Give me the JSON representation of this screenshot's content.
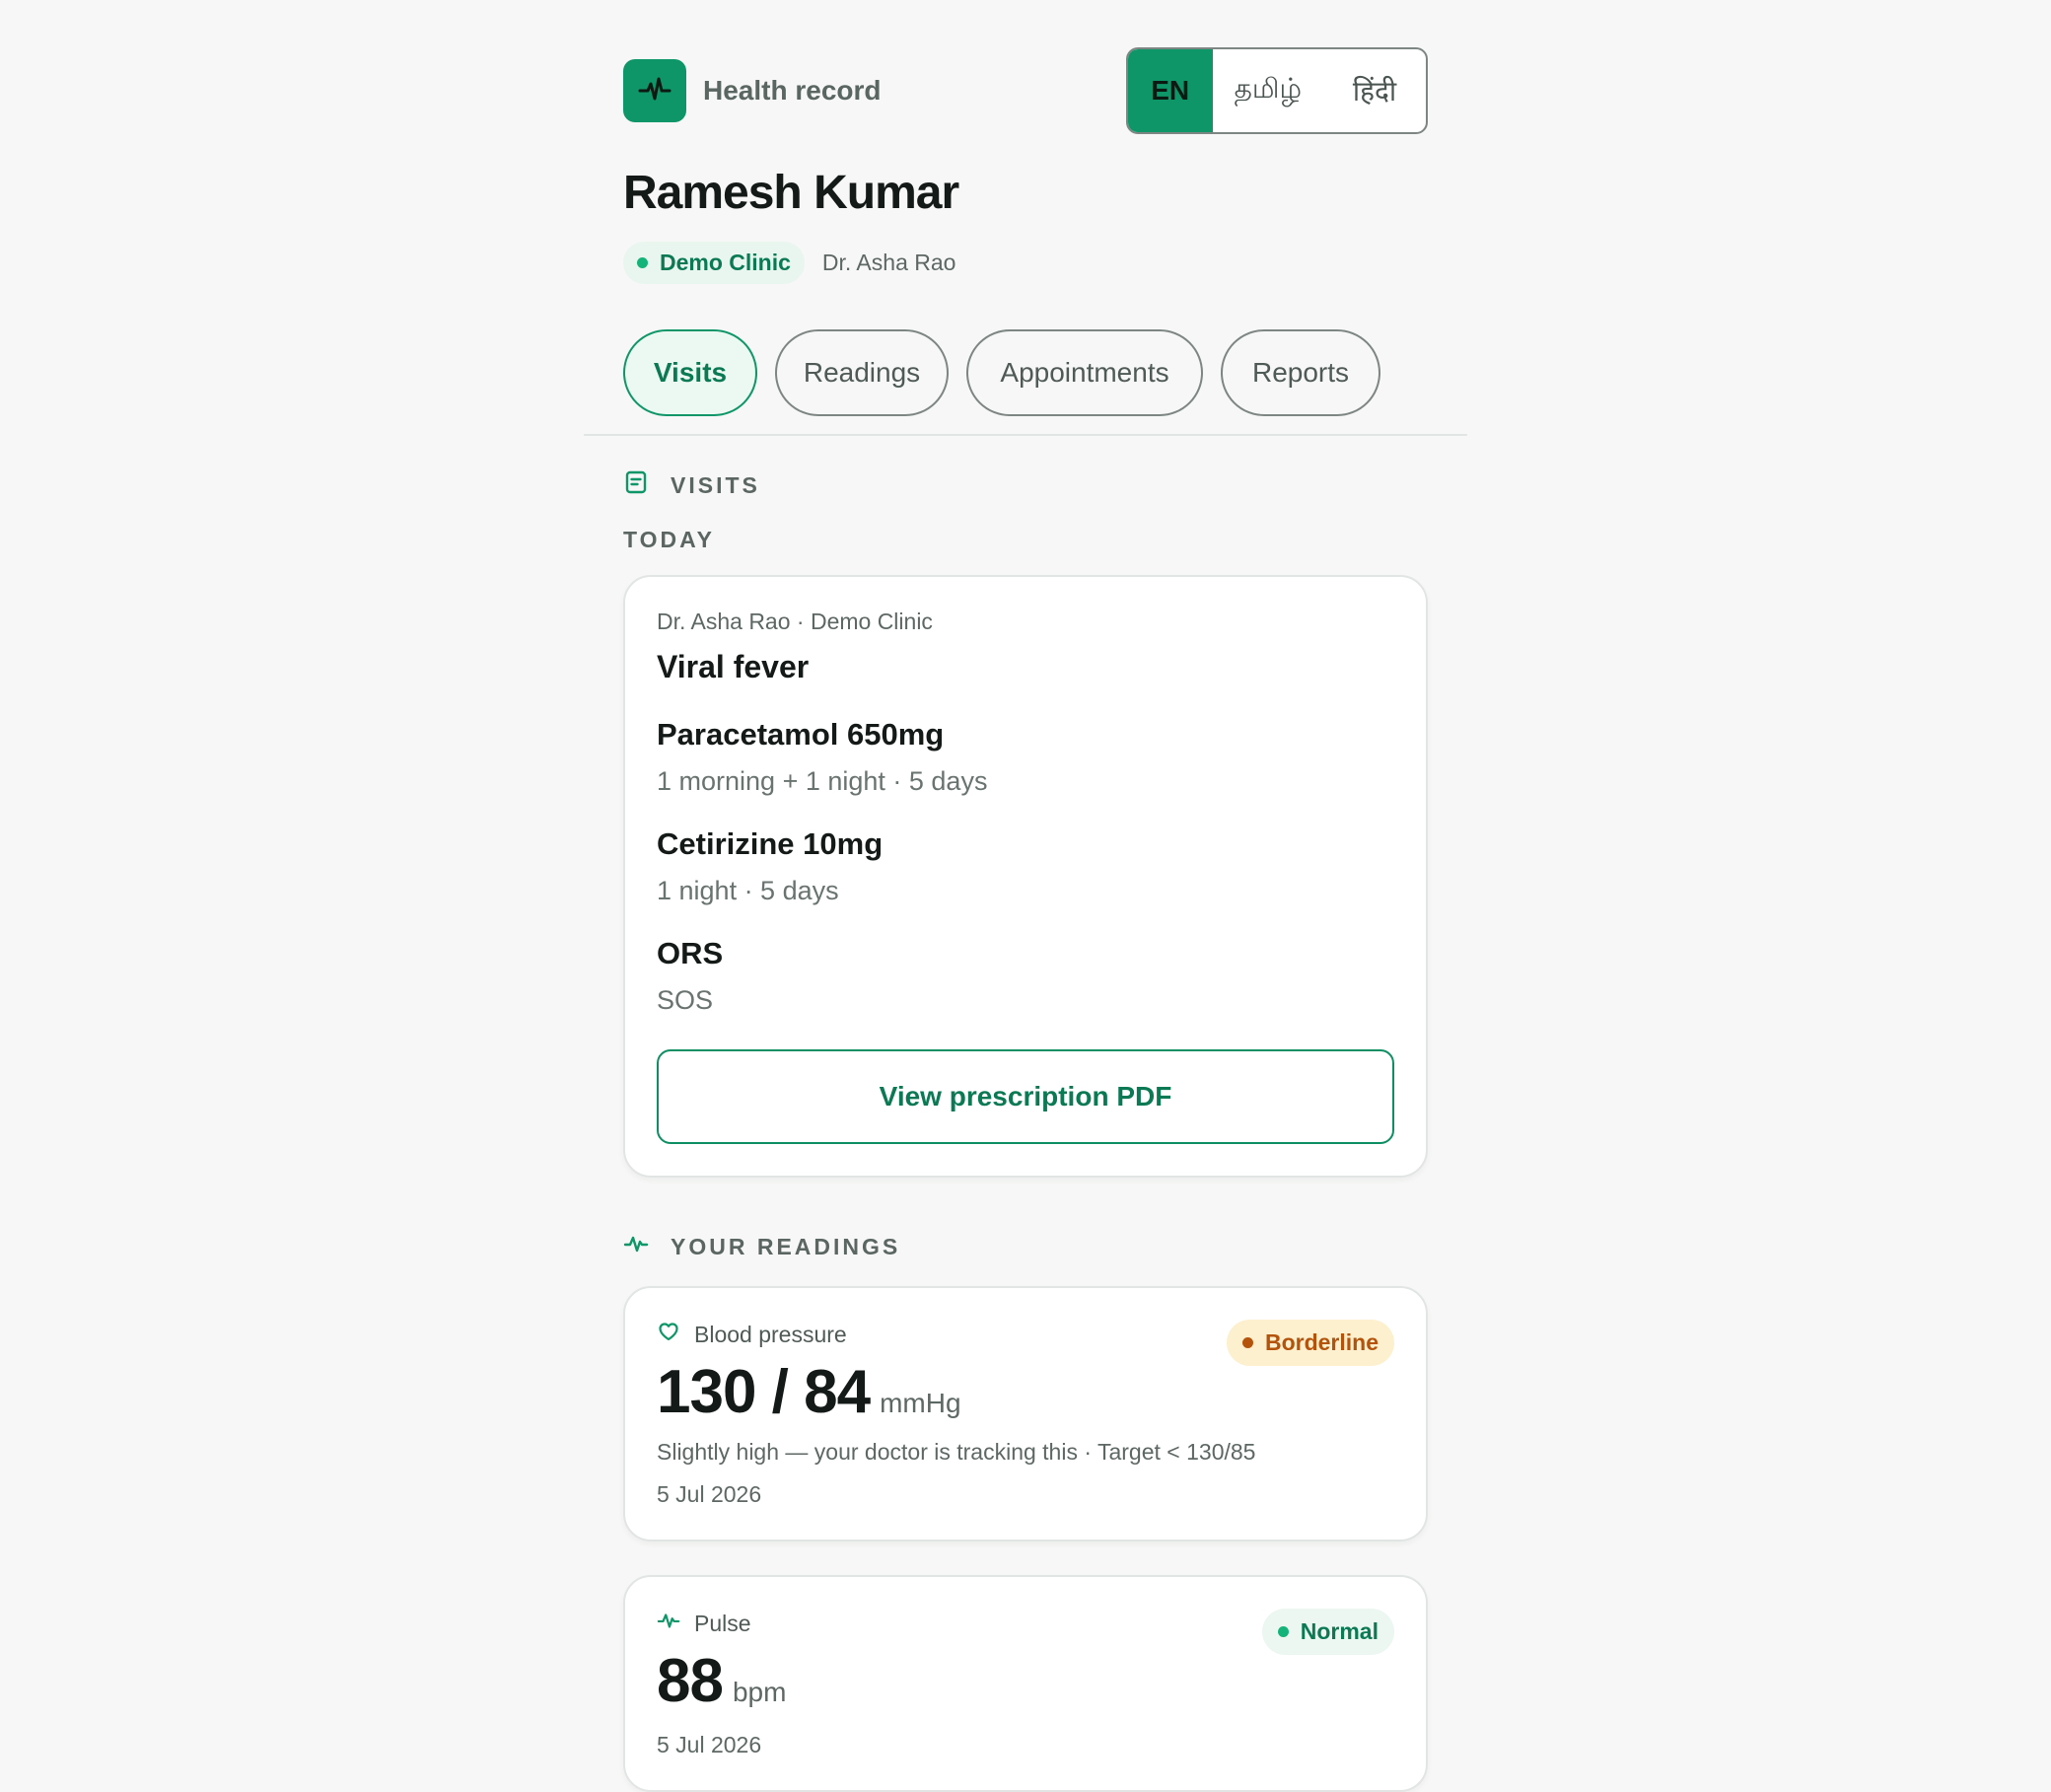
{
  "header": {
    "app_title": "Health record",
    "languages": [
      {
        "label": "EN",
        "active": true
      },
      {
        "label": "தமிழ்",
        "active": false
      },
      {
        "label": "हिंदी",
        "active": false
      }
    ]
  },
  "patient": {
    "name": "Ramesh Kumar",
    "clinic": "Demo Clinic",
    "doctor": "Dr. Asha Rao"
  },
  "tabs": [
    {
      "label": "Visits",
      "active": true
    },
    {
      "label": "Readings",
      "active": false
    },
    {
      "label": "Appointments",
      "active": false
    },
    {
      "label": "Reports",
      "active": false
    }
  ],
  "visits": {
    "heading": "VISITS",
    "group_label": "TODAY",
    "entry": {
      "meta": "Dr. Asha Rao · Demo Clinic",
      "diagnosis": "Viral fever",
      "medicines": [
        {
          "name": "Paracetamol 650mg",
          "dose": "1 morning + 1 night · 5 days"
        },
        {
          "name": "Cetirizine 10mg",
          "dose": "1 night · 5 days"
        },
        {
          "name": "ORS",
          "dose": "SOS"
        }
      ],
      "pdf_button": "View prescription PDF"
    }
  },
  "readings": {
    "heading": "YOUR READINGS",
    "items": [
      {
        "label": "Blood pressure",
        "icon": "heart-shield-icon",
        "value": "130 / 84",
        "unit": "mmHg",
        "status": "Borderline",
        "status_color": "#b4530b",
        "note": "Slightly high — your doctor is tracking this · Target < 130/85",
        "date": "5 Jul 2026"
      },
      {
        "label": "Pulse",
        "icon": "pulse-icon",
        "value": "88",
        "unit": "bpm",
        "status": "Normal",
        "status_color": "#14b37a",
        "date": "5 Jul 2026"
      }
    ]
  },
  "colors": {
    "accent": "#0e9668",
    "accent_text": "#0b7a54",
    "background": "#f6f7f6"
  }
}
